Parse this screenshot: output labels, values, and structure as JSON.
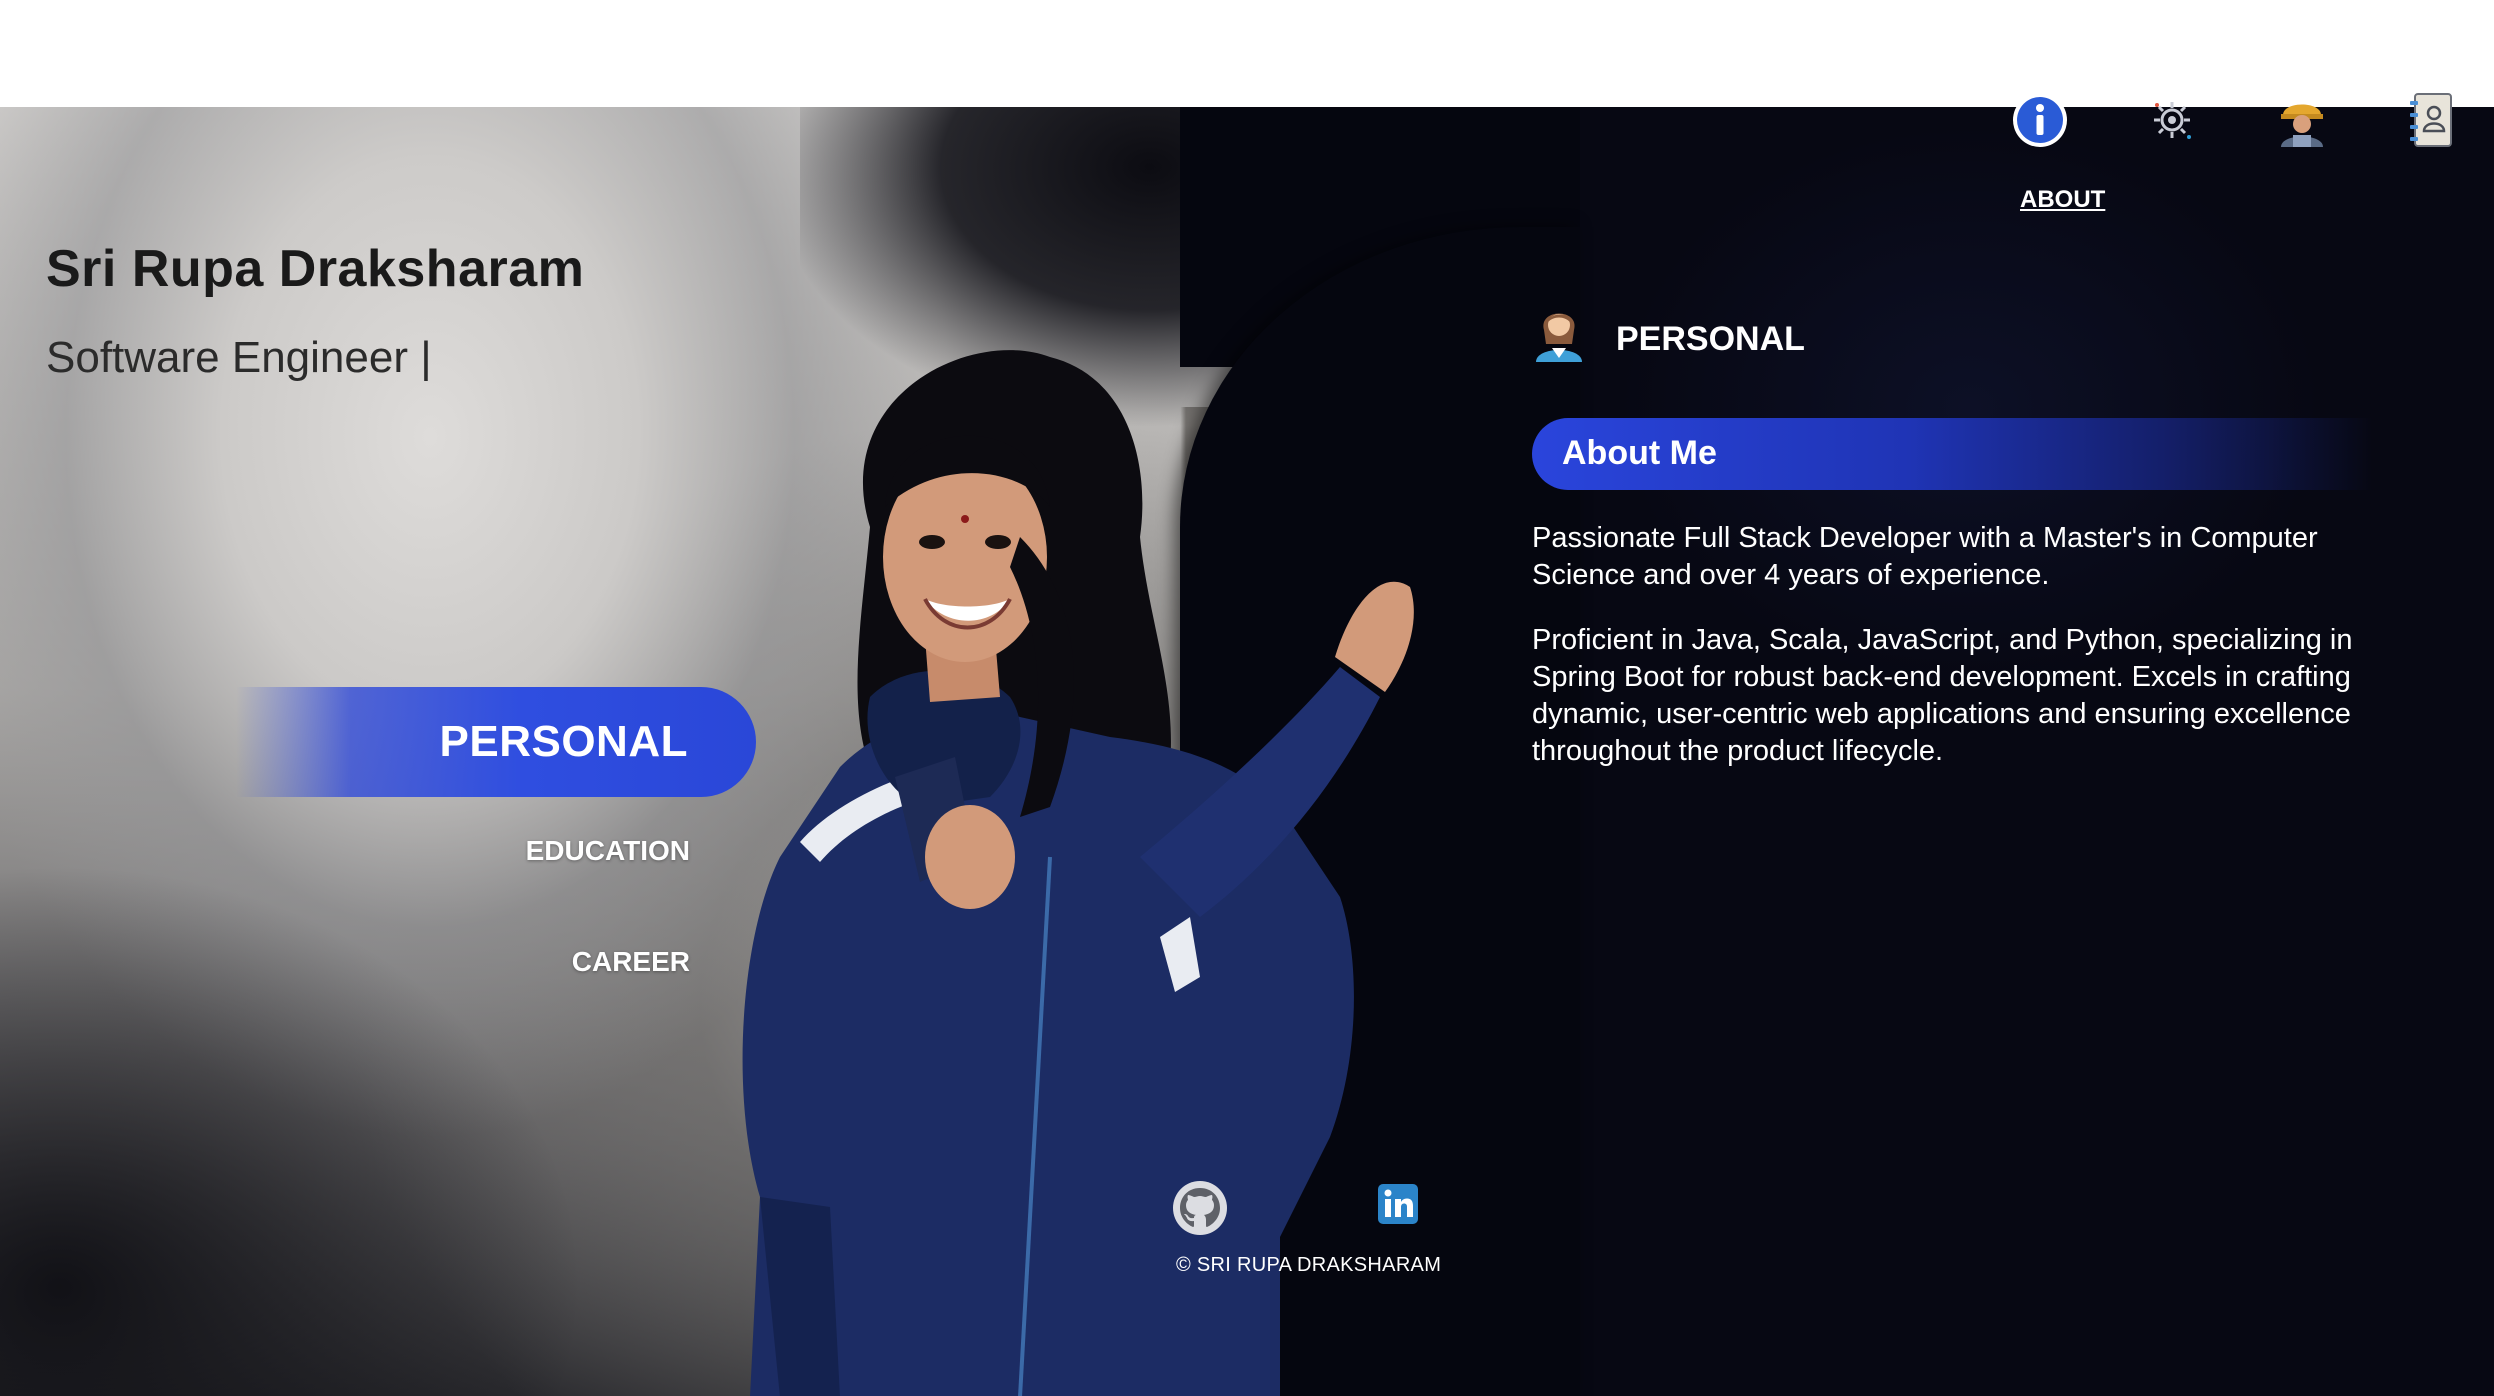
{
  "header": {
    "name": "Sri Rupa Draksharam",
    "role": "Software Engineer |"
  },
  "sections": {
    "active": "PERSONAL",
    "items": [
      "EDUCATION",
      "CAREER"
    ]
  },
  "topnav": {
    "items": [
      {
        "icon": "info-icon"
      },
      {
        "icon": "gear-icon"
      },
      {
        "icon": "worker-icon"
      },
      {
        "icon": "contact-book-icon"
      }
    ],
    "active_label": "ABOUT"
  },
  "content": {
    "section_title": "PERSONAL",
    "subheading": "About Me",
    "paragraphs": [
      "Passionate Full Stack Developer with a Master's in Computer Science and over 4 years of experience.",
      "Proficient in Java, Scala, JavaScript, and Python, specializing in Spring Boot for robust back-end development. Excels in crafting dynamic, user-centric web applications and ensuring excellence throughout the product lifecycle."
    ]
  },
  "social": {
    "github": "github-icon",
    "linkedin": "linkedin-icon"
  },
  "footer": {
    "copyright": "© SRI RUPA DRAKSHARAM"
  },
  "colors": {
    "accent": "#2f4ee0",
    "panel": "#06070f",
    "text_light": "#ffffff"
  }
}
